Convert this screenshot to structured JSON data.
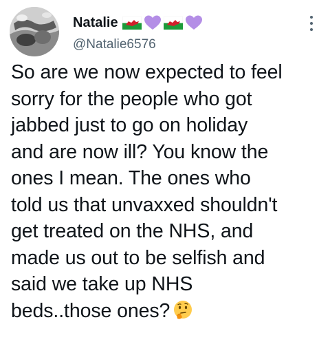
{
  "tweet": {
    "author": {
      "display_name": "Natalie",
      "handle": "@Natalie6576",
      "name_emojis": [
        "wales-flag-icon",
        "purple-heart-icon",
        "wales-flag-icon",
        "purple-heart-icon"
      ]
    },
    "more_icon": "more-options-icon",
    "text_lines": [
      "So are we now expected to feel",
      "sorry for the people who got",
      "jabbed just to go on holiday",
      "and are now ill? You know the",
      "ones I mean. The ones who",
      "told us that unvaxxed shouldn't",
      "get treated on the NHS, and",
      "made us out to be selfish and",
      "said we take up NHS",
      "beds..those ones?"
    ],
    "trailing_emoji": "thinking-face-icon"
  },
  "colors": {
    "text_primary": "#0f1419",
    "text_secondary": "#536471",
    "heart_purple": "#b48ee6",
    "flag_green": "#1d9b3a",
    "flag_red": "#d21f2b"
  }
}
